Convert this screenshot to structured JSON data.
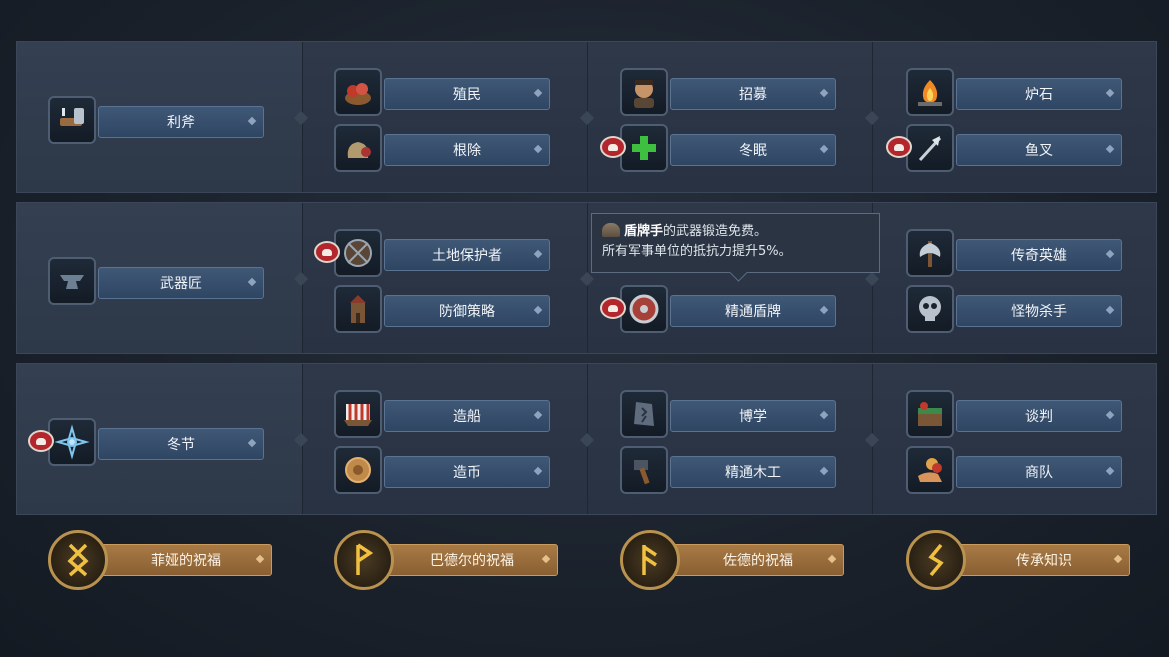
{
  "rows": [
    {
      "first": {
        "label": "利斧",
        "icon": "axe-hammer-icon"
      },
      "cols": [
        [
          {
            "label": "殖民",
            "icon": "food-basket-icon"
          },
          {
            "label": "根除",
            "icon": "sack-icon"
          }
        ],
        [
          {
            "label": "招募",
            "icon": "warrior-portrait-icon"
          },
          {
            "label": "冬眠",
            "icon": "green-cross-icon",
            "locked": true
          }
        ],
        [
          {
            "label": "炉石",
            "icon": "hearth-fire-icon"
          },
          {
            "label": "鱼叉",
            "icon": "harpoon-icon",
            "locked": true
          }
        ]
      ]
    },
    {
      "first": {
        "label": "武器匠",
        "icon": "anvil-icon"
      },
      "cols": [
        [
          {
            "label": "土地保护者",
            "icon": "round-shield-icon",
            "locked": true
          },
          {
            "label": "防御策略",
            "icon": "watchtower-icon"
          }
        ],
        [
          {
            "label": "",
            "icon": ""
          },
          {
            "label": "精通盾牌",
            "icon": "red-shield-icon",
            "locked": true
          }
        ],
        [
          {
            "label": "传奇英雄",
            "icon": "battle-axe-icon"
          },
          {
            "label": "怪物杀手",
            "icon": "skull-icon"
          }
        ]
      ]
    },
    {
      "first": {
        "label": "冬节",
        "icon": "snowflake-rune-icon",
        "locked": true
      },
      "cols": [
        [
          {
            "label": "造船",
            "icon": "longship-icon"
          },
          {
            "label": "造币",
            "icon": "coin-icon"
          }
        ],
        [
          {
            "label": "博学",
            "icon": "rune-stone-icon"
          },
          {
            "label": "精通木工",
            "icon": "woodwork-hammer-icon"
          }
        ],
        [
          {
            "label": "谈判",
            "icon": "trade-chest-icon"
          },
          {
            "label": "商队",
            "icon": "coins-hand-icon"
          }
        ]
      ]
    }
  ],
  "tooltip": {
    "title": "盾牌手",
    "line1_rest": "的武器锻造免费。",
    "line2": "所有军事单位的抵抗力提升5%。"
  },
  "blessings": [
    {
      "label": "菲娅的祝福",
      "rune": "ᛝ"
    },
    {
      "label": "巴德尔的祝福",
      "rune": "ᚹ"
    },
    {
      "label": "佐德的祝福",
      "rune": "ᚨ"
    },
    {
      "label": "传承知识",
      "rune": "ᛊ"
    }
  ],
  "colors": {
    "bar_blue": "#3f5876",
    "bar_gold": "#a87a45",
    "badge_red": "#b3262d",
    "rune_gold": "#f0c040"
  }
}
